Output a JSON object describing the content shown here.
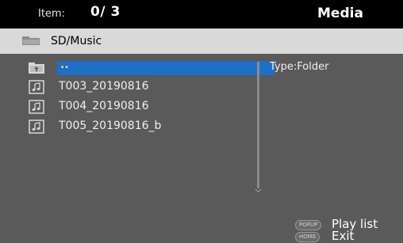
{
  "header": {
    "item_label": "Item:",
    "item_count": "0/ 3",
    "mode_title": "Media"
  },
  "path": {
    "text": "SD/Music",
    "icon": "folder-icon"
  },
  "files": [
    {
      "name": "..",
      "icon": "parent-folder-icon",
      "selected": true
    },
    {
      "name": "T003_20190816",
      "icon": "music-file-icon",
      "selected": false
    },
    {
      "name": "T004_20190816",
      "icon": "music-file-icon",
      "selected": false
    },
    {
      "name": "T005_20190816_b",
      "icon": "music-file-icon",
      "selected": false
    }
  ],
  "info": {
    "type": "Type:Folder"
  },
  "footer": {
    "popup_key": "POPUP",
    "popup_action": "Play list",
    "home_key": "HOME",
    "home_action": "Exit"
  },
  "colors": {
    "background": "#5a5a5a",
    "header": "#000000",
    "pathbar": "#d9d9d9",
    "selection": "#1f6fc7",
    "selected_text": "#ffd84a"
  }
}
